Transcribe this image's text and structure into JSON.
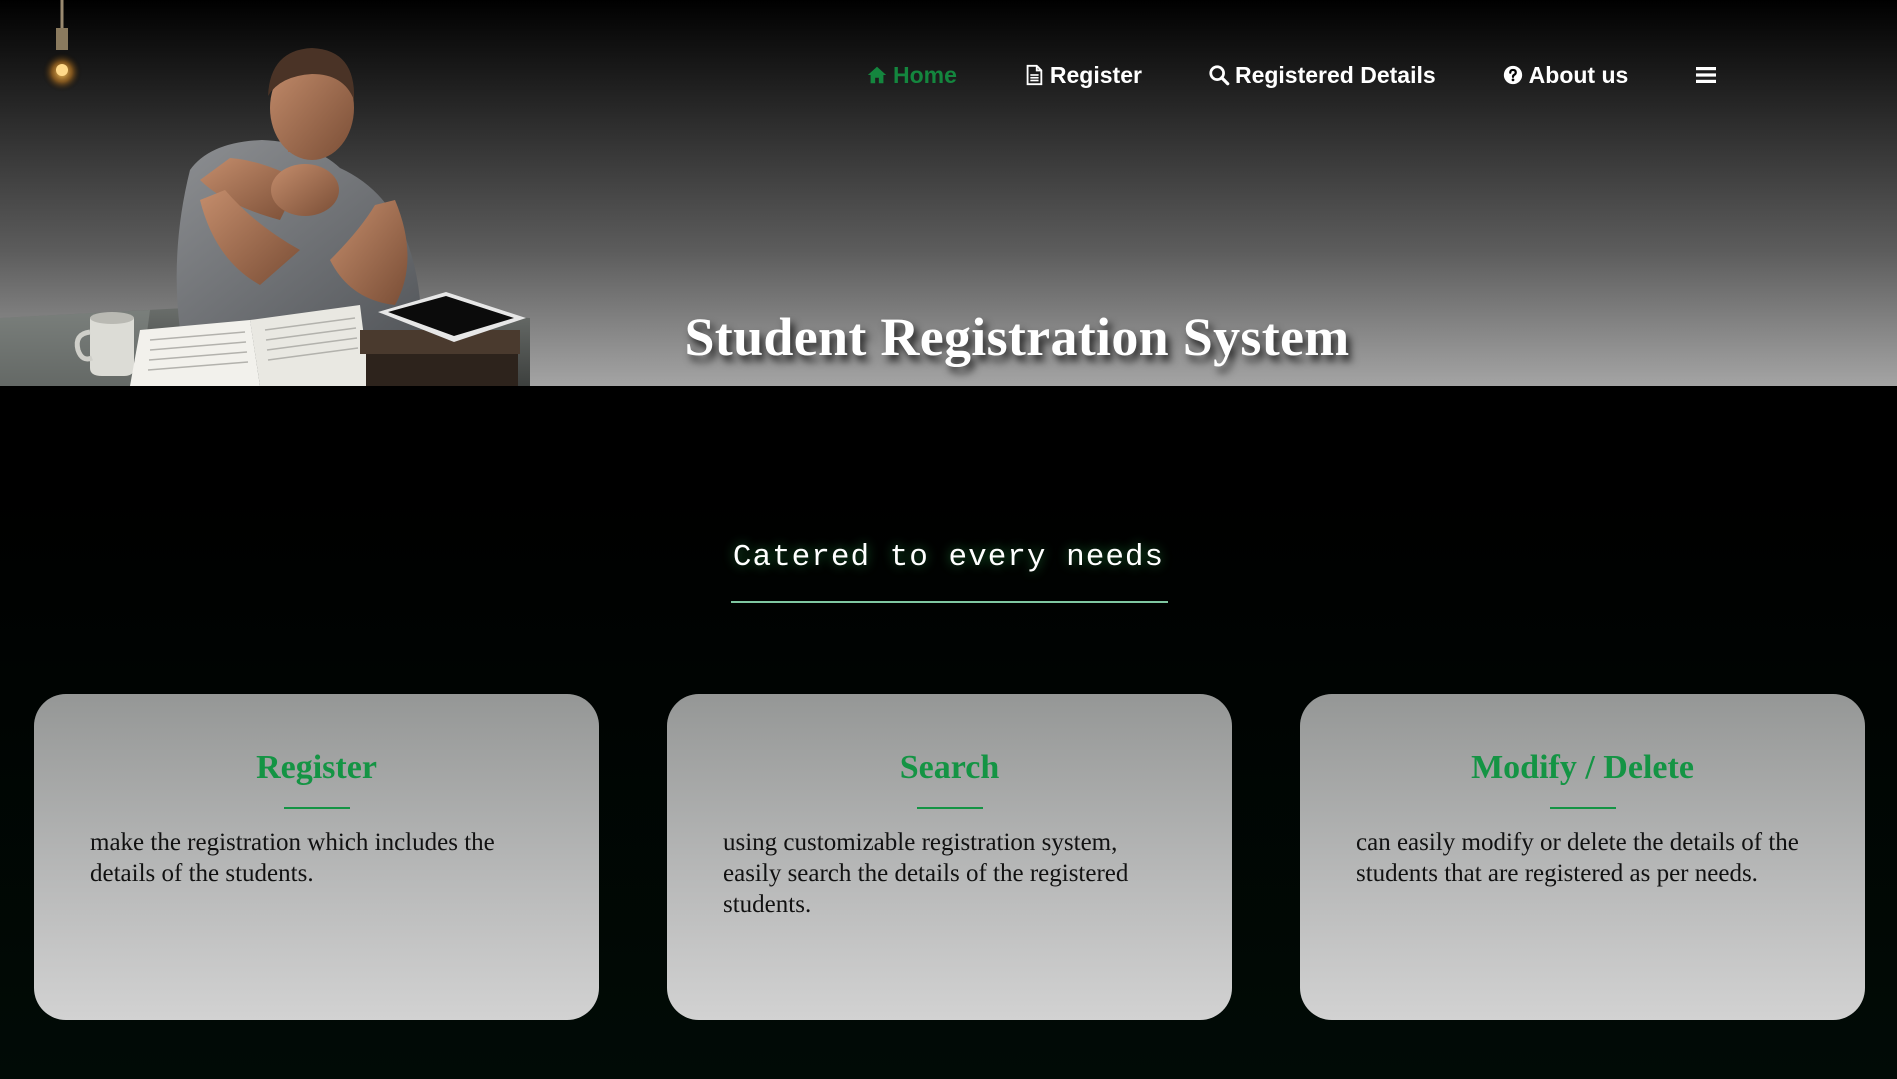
{
  "nav": {
    "items": [
      {
        "label": "Home",
        "icon": "home-icon",
        "active": true
      },
      {
        "label": "Register",
        "icon": "document-icon",
        "active": false
      },
      {
        "label": "Registered Details",
        "icon": "search-icon",
        "active": false
      },
      {
        "label": "About us",
        "icon": "question-circle-icon",
        "active": false
      }
    ],
    "menu_icon": "hamburger-menu-icon"
  },
  "hero": {
    "title": "Student Registration System",
    "illustration": "student-studying-at-desk-illustration"
  },
  "section": {
    "heading": "Catered to every needs"
  },
  "cards": [
    {
      "title": "Register",
      "text": "make the registration which includes the details of the students."
    },
    {
      "title": "Search",
      "text": "using customizable registration system, easily search the details of the registered students."
    },
    {
      "title": "Modify / Delete",
      "text": "can easily modify or delete the details of the students that are registered as per needs."
    }
  ],
  "colors": {
    "accent_green": "#149444",
    "nav_active": "#14863e",
    "underline": "#7fc7a1"
  }
}
